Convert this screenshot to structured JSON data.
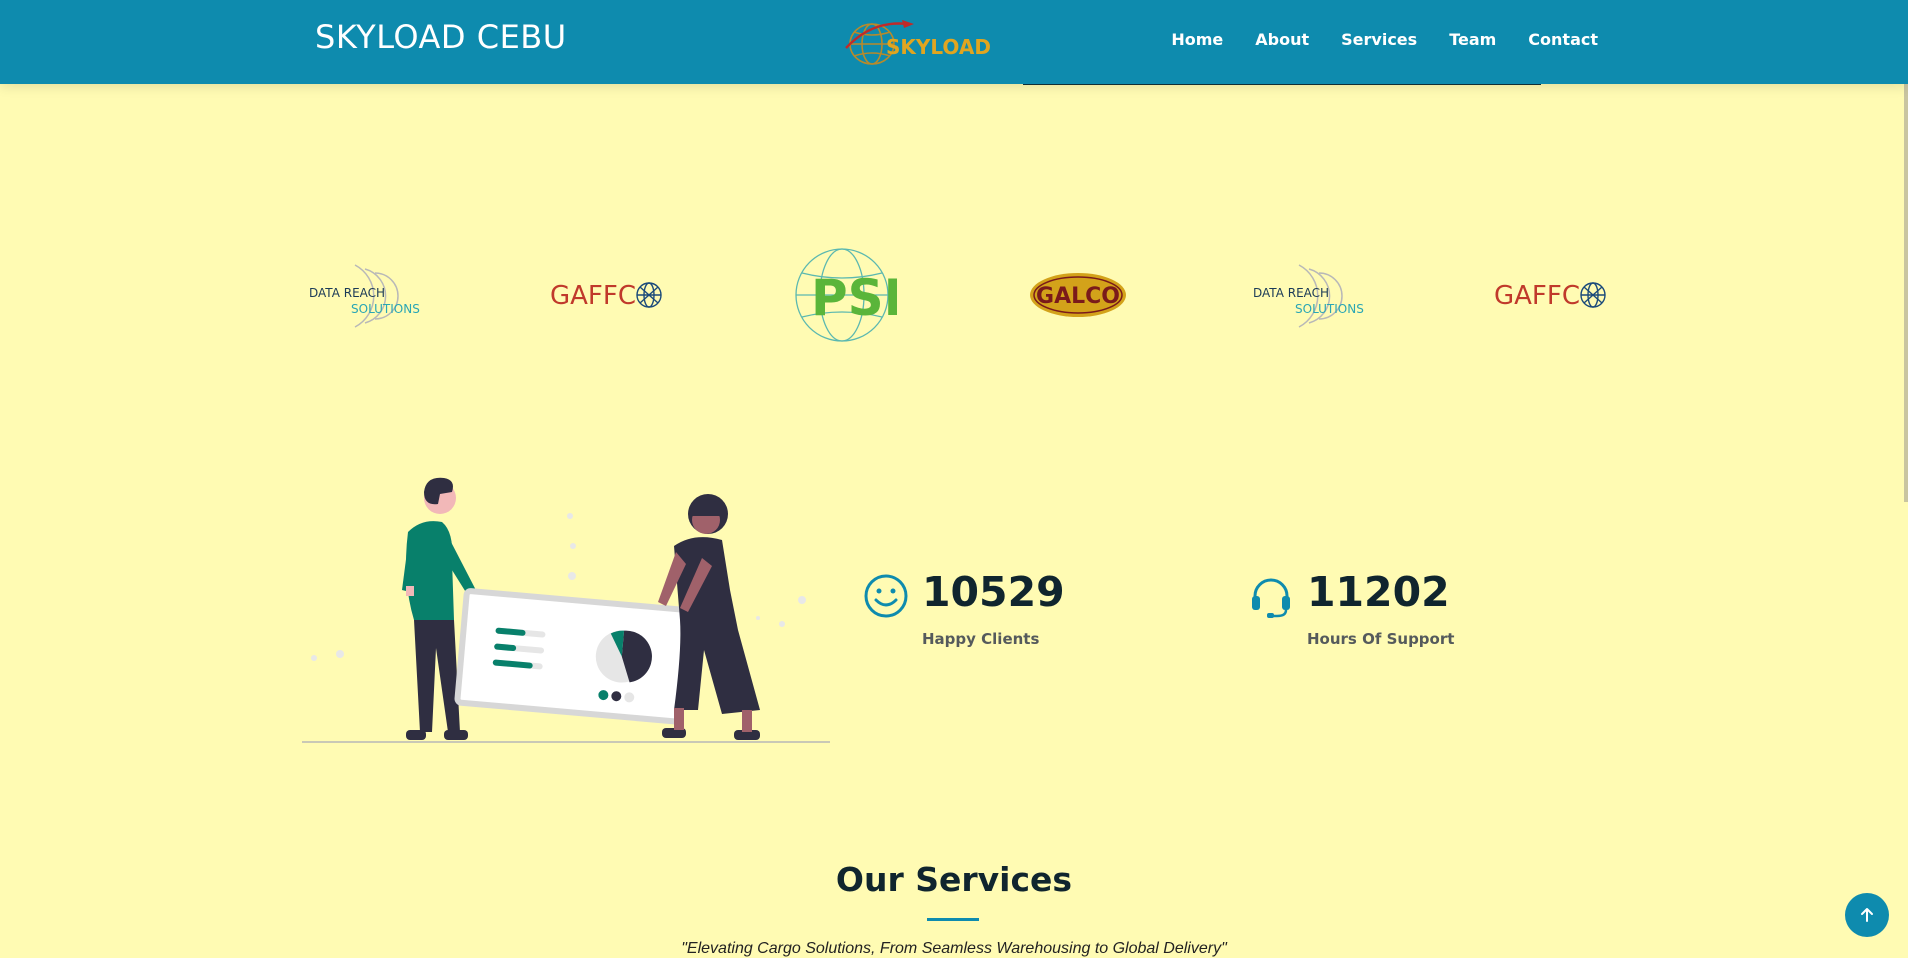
{
  "header": {
    "title": "SKYLOAD CEBU",
    "logo_text": "SKYLOAD",
    "nav": [
      "Home",
      "About",
      "Services",
      "Team",
      "Contact"
    ]
  },
  "clients": [
    {
      "name": "Data Reach Solutions",
      "line1": "DATA REACH",
      "line2": "SOLUTIONS"
    },
    {
      "name": "GAFFCO",
      "text": "GAFFC"
    },
    {
      "name": "PSI",
      "text": "PSI"
    },
    {
      "name": "GALCO",
      "text": "GALCO"
    },
    {
      "name": "Data Reach Solutions",
      "line1": "DATA REACH",
      "line2": "SOLUTIONS"
    },
    {
      "name": "GAFFCO",
      "text": "GAFFC"
    }
  ],
  "stats": [
    {
      "icon": "smile-icon",
      "value": "10529",
      "label": "Happy Clients"
    },
    {
      "icon": "headset-icon",
      "value": "11202",
      "label": "Hours Of Support"
    }
  ],
  "services": {
    "title": "Our Services",
    "subtitle": "\"Elevating Cargo Solutions, From Seamless Warehousing to Global Delivery\""
  },
  "colors": {
    "header": "#0e8bae",
    "background": "#fffbb3",
    "accent": "#0e8bae"
  }
}
